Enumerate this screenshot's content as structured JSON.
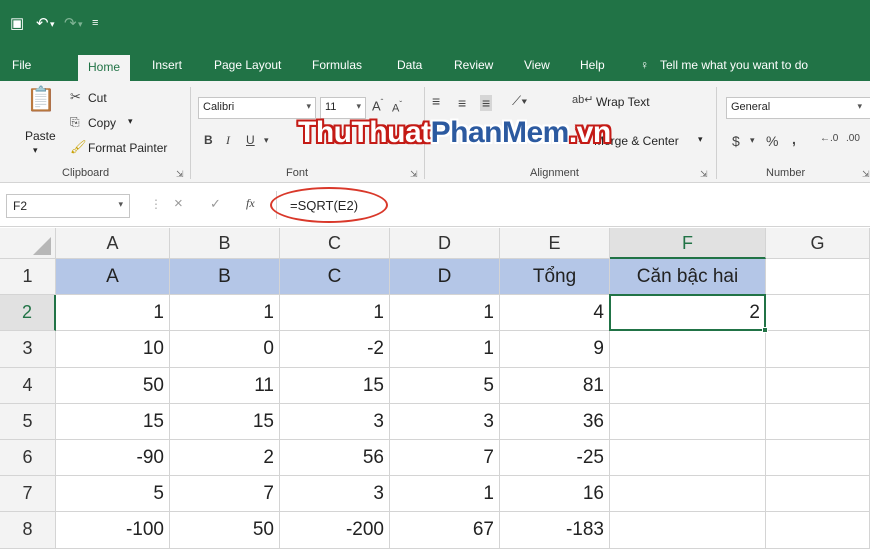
{
  "quick_access": {
    "save_icon": "save-icon",
    "undo_icon": "undo-icon",
    "redo_icon": "redo-icon"
  },
  "tabs": [
    "File",
    "Home",
    "Insert",
    "Page Layout",
    "Formulas",
    "Data",
    "Review",
    "View",
    "Help"
  ],
  "tell_me": "Tell me what you want to do",
  "ribbon": {
    "clipboard": {
      "paste": "Paste",
      "cut": "Cut",
      "copy": "Copy",
      "format_painter": "Format Painter",
      "label": "Clipboard"
    },
    "font": {
      "name": "Calibri",
      "size": "11",
      "bold": "B",
      "italic": "I",
      "underline": "U",
      "label": "Font"
    },
    "alignment": {
      "wrap_text": "Wrap Text",
      "merge_center": "Merge & Center",
      "label": "Alignment"
    },
    "number": {
      "format": "General",
      "currency": "$",
      "percent": "%",
      "comma": ",",
      "label": "Number"
    }
  },
  "watermark": {
    "part1": "ThuThuat",
    "part2": "PhanMem",
    "part3": ".vn"
  },
  "formula_bar": {
    "name_box": "F2",
    "cancel": "×",
    "enter": "✓",
    "fx": "fx",
    "formula": "=SQRT(E2)"
  },
  "sheet": {
    "columns": [
      "A",
      "B",
      "C",
      "D",
      "E",
      "F",
      "G"
    ],
    "rows": [
      "1",
      "2",
      "3",
      "4",
      "5",
      "6",
      "7",
      "8"
    ],
    "header_row": [
      "A",
      "B",
      "C",
      "D",
      "Tổng",
      "Căn bậc hai"
    ],
    "data": [
      [
        "1",
        "1",
        "1",
        "1",
        "4",
        "2"
      ],
      [
        "10",
        "0",
        "-2",
        "1",
        "9",
        ""
      ],
      [
        "50",
        "11",
        "15",
        "5",
        "81",
        ""
      ],
      [
        "15",
        "15",
        "3",
        "3",
        "36",
        ""
      ],
      [
        "-90",
        "2",
        "56",
        "7",
        "-25",
        ""
      ],
      [
        "5",
        "7",
        "3",
        "1",
        "16",
        ""
      ],
      [
        "-100",
        "50",
        "-200",
        "67",
        "-183",
        ""
      ]
    ],
    "selected_cell": "F2"
  },
  "colors": {
    "excel_green": "#217346",
    "header_fill": "#b4c6e7",
    "annotation_red": "#d9382a"
  }
}
